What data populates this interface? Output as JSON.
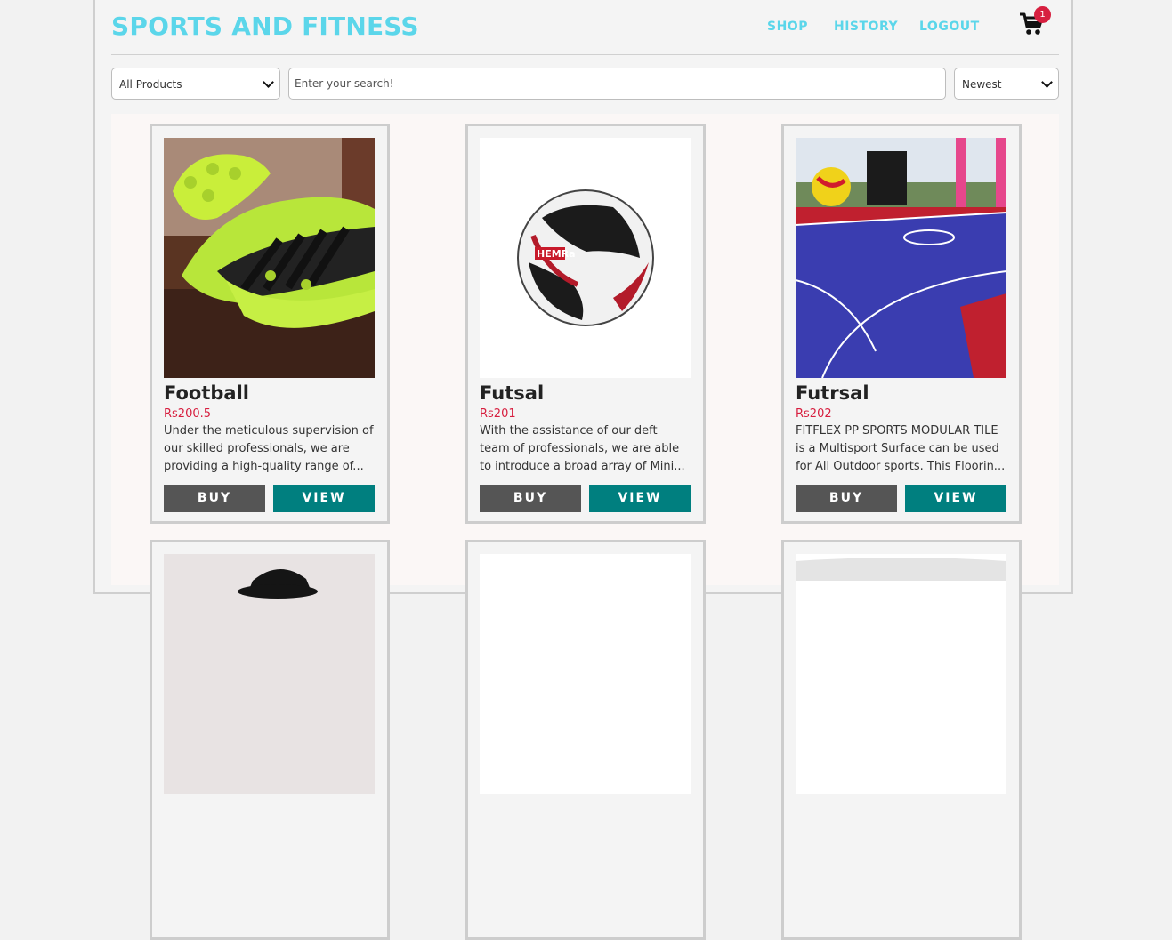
{
  "header": {
    "brand": "SPORTS AND FITNESS",
    "nav": [
      "SHOP",
      "HISTORY",
      "LOGOUT"
    ],
    "cart_count": "1",
    "cart_icon": "shopping-cart-icon",
    "accent": "#5bd6ea"
  },
  "filters": {
    "category": "All Products",
    "search_placeholder": "Enter your search!",
    "sort": "Newest"
  },
  "products": [
    {
      "name": "Football",
      "price": "Rs200.5",
      "description": "Under the meticulous supervision of our skilled professionals, we are providing a high-quality range of...",
      "buy": "BUY",
      "view": "VIEW"
    },
    {
      "name": "Futsal",
      "price": "Rs201",
      "description": "With the assistance of our deft team of professionals, we are able to introduce a broad array of Mini...",
      "buy": "BUY",
      "view": "VIEW"
    },
    {
      "name": "Futrsal",
      "price": "Rs202",
      "description": "FITFLEX PP SPORTS MODULAR TILE is a Multisport Surface can be used for All Outdoor sports. This Floorin...",
      "buy": "BUY",
      "view": "VIEW"
    }
  ],
  "colors": {
    "price": "#d71f3f",
    "buy_button": "#555555",
    "view_button": "#007f7f",
    "badge": "#d71f3f"
  }
}
